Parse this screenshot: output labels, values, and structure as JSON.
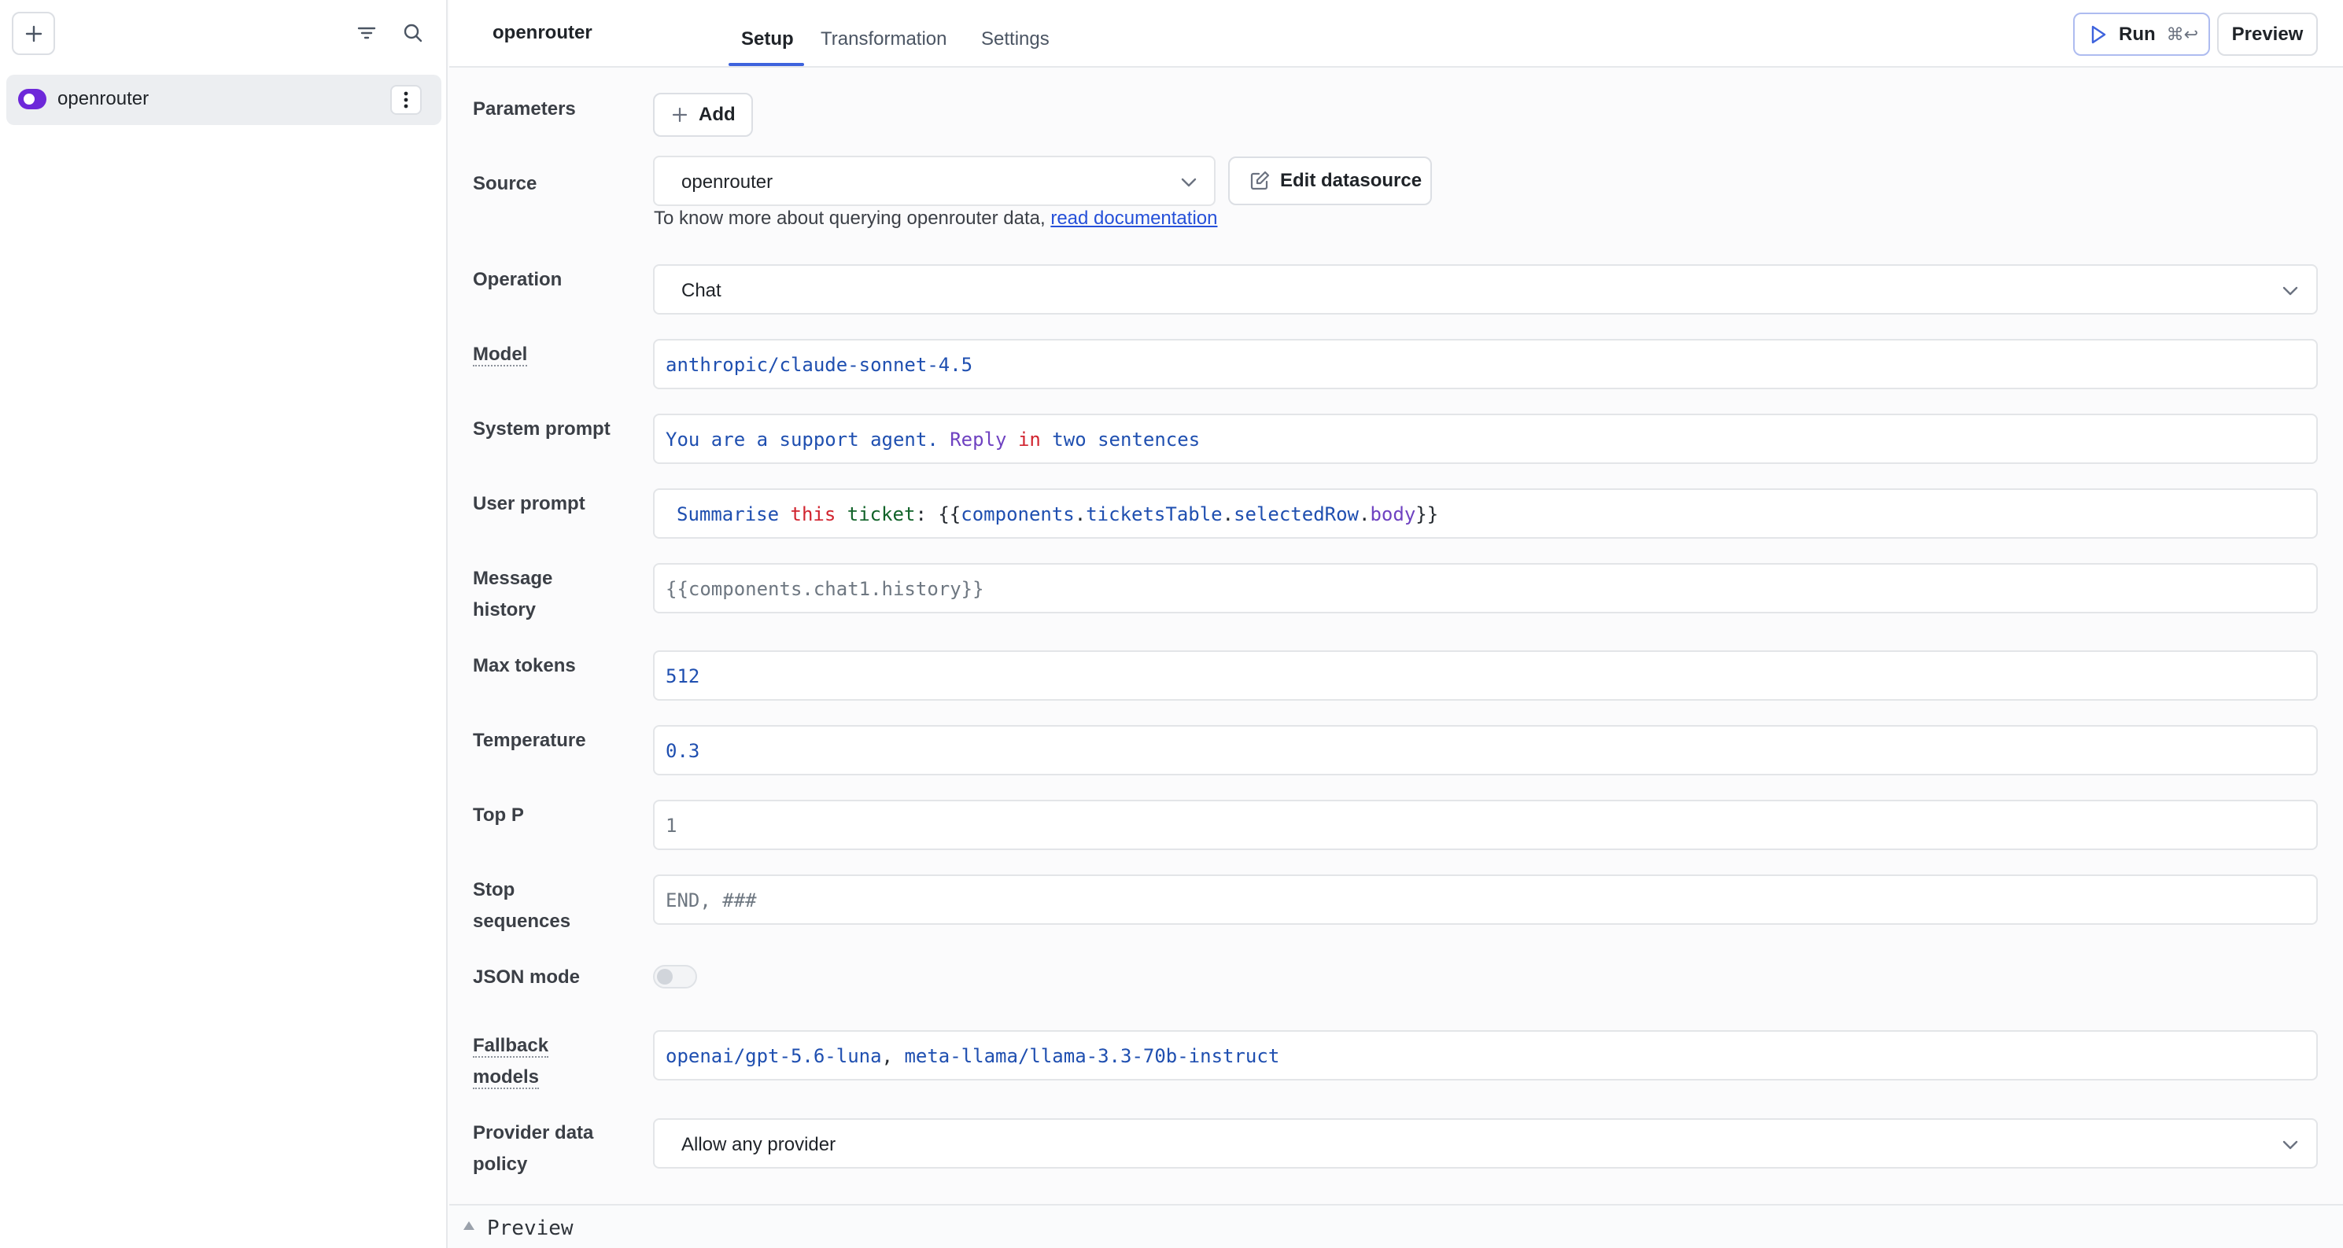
{
  "sidebar": {
    "item": {
      "label": "openrouter"
    }
  },
  "header": {
    "query_name": "openrouter",
    "tabs": [
      {
        "label": "Setup",
        "active": true
      },
      {
        "label": "Transformation",
        "active": false
      },
      {
        "label": "Settings",
        "active": false
      }
    ],
    "run_label": "Run",
    "run_shortcut": "⌘↩",
    "preview_label": "Preview"
  },
  "form": {
    "parameters": {
      "label": "Parameters",
      "add_label": "Add"
    },
    "source": {
      "label": "Source",
      "value": "openrouter",
      "edit_label": "Edit datasource",
      "help_text": "To know more about querying openrouter data, ",
      "help_link": "read documentation"
    },
    "operation": {
      "label": "Operation",
      "value": "Chat"
    },
    "model": {
      "label": "Model",
      "value": "anthropic/claude-sonnet-4.5"
    },
    "system_prompt": {
      "label": "System prompt",
      "tokens": [
        "You are a support agent.",
        "Reply",
        "in",
        "two sentences"
      ]
    },
    "user_prompt": {
      "label": "User prompt",
      "tokens": [
        "Summarise",
        "this",
        "ticket",
        ":",
        "{{",
        "components",
        ".",
        "ticketsTable",
        ".",
        "selectedRow",
        ".",
        "body",
        "}}"
      ]
    },
    "message_history": {
      "label_line1": "Message",
      "label_line2": "history",
      "placeholder": "{{components.chat1.history}}"
    },
    "max_tokens": {
      "label": "Max tokens",
      "value": "512"
    },
    "temperature": {
      "label": "Temperature",
      "value": "0.3"
    },
    "top_p": {
      "label": "Top P",
      "placeholder": "1"
    },
    "stop_sequences": {
      "label_line1": "Stop",
      "label_line2": "sequences",
      "placeholder": "END, ###"
    },
    "json_mode": {
      "label": "JSON mode",
      "enabled": false
    },
    "fallback_models": {
      "label_line1": "Fallback",
      "label_line2": "models",
      "model_1": "openai/gpt-5.6-luna",
      "separator": ", ",
      "model_2": "meta-llama/llama-3.3-70b-instruct"
    },
    "provider_policy": {
      "label_line1": "Provider data",
      "label_line2": "policy",
      "value": "Allow any provider"
    }
  },
  "preview_bar": {
    "label": "Preview"
  },
  "colors": {
    "accent": "#3e63dd",
    "brand": "#6d28d9",
    "link": "#2550d9"
  }
}
